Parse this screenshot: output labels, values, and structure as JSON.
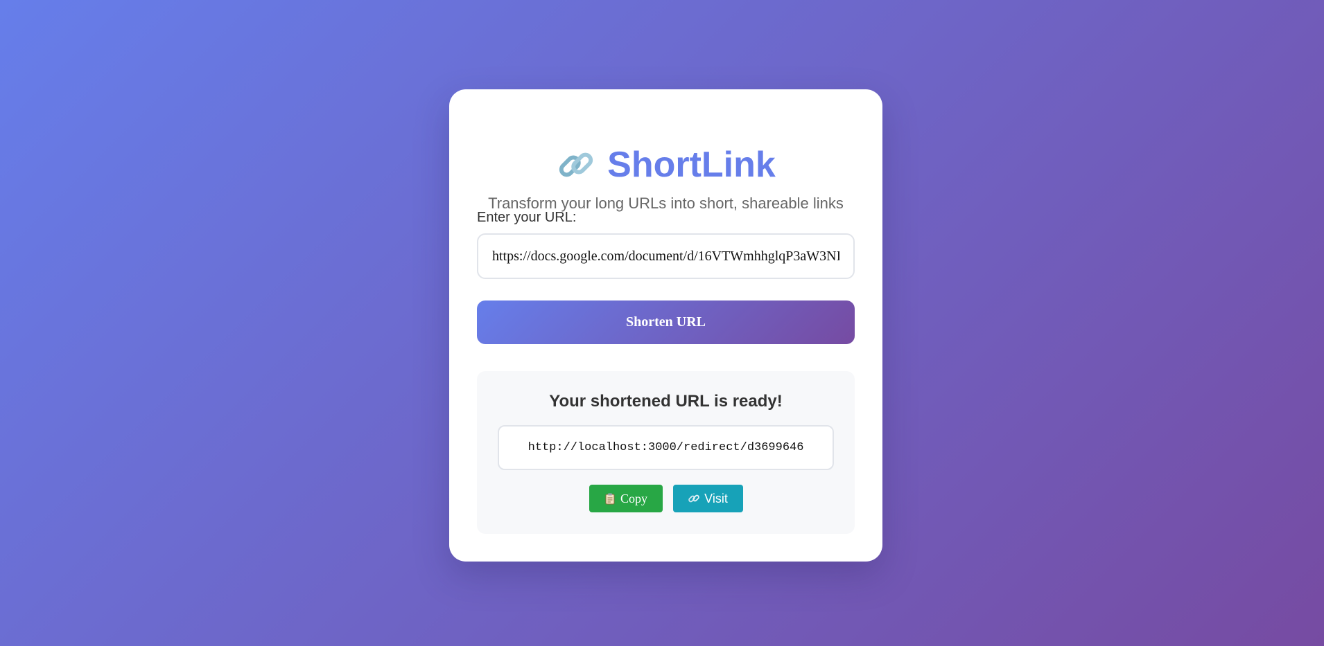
{
  "app": {
    "title": "ShortLink",
    "subtitle": "Transform your long URLs into short, shareable links",
    "title_icon": "link-icon"
  },
  "form": {
    "label": "Enter your URL:",
    "url_value": "https://docs.google.com/document/d/16VTWmhhglqP3aW3NI",
    "submit_label": "Shorten URL"
  },
  "result": {
    "heading": "Your shortened URL is ready!",
    "short_url": "http://localhost:3000/redirect/d3699646",
    "copy_label": "Copy",
    "copy_icon": "clipboard-icon",
    "visit_label": "Visit",
    "visit_icon": "link-icon"
  },
  "colors": {
    "gradient_start": "#667eea",
    "gradient_end": "#764ba2",
    "title": "#667eea",
    "copy_button": "#28a745",
    "visit_button": "#17a2b8"
  }
}
